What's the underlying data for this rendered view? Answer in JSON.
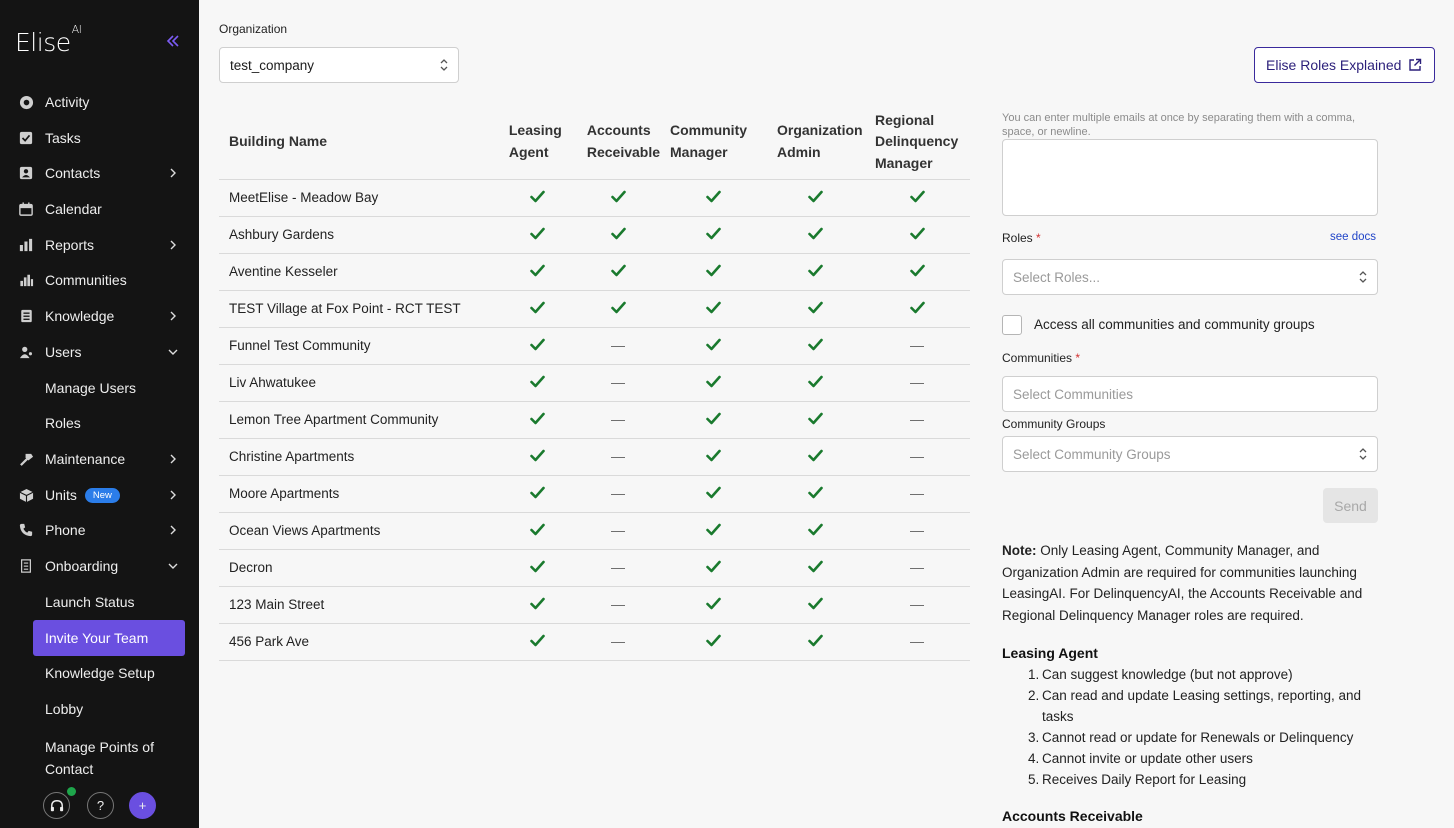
{
  "sidebar": {
    "logo": "Elise",
    "logo_suffix": "AI",
    "nav": [
      {
        "label": "Activity",
        "icon": "activity-icon"
      },
      {
        "label": "Tasks",
        "icon": "tasks-icon"
      },
      {
        "label": "Contacts",
        "icon": "contacts-icon"
      },
      {
        "label": "Calendar",
        "icon": "calendar-icon"
      },
      {
        "label": "Reports",
        "icon": "reports-icon"
      },
      {
        "label": "Communities",
        "icon": "communities-icon"
      },
      {
        "label": "Knowledge",
        "icon": "knowledge-icon"
      },
      {
        "label": "Users",
        "icon": "users-icon"
      },
      {
        "label": "Maintenance",
        "icon": "hammer-icon"
      },
      {
        "label": "Units",
        "icon": "box-icon",
        "badge": "New"
      },
      {
        "label": "Phone",
        "icon": "phone-icon"
      },
      {
        "label": "Onboarding",
        "icon": "building-icon"
      }
    ],
    "users_sub": [
      "Manage Users",
      "Roles"
    ],
    "onboarding_sub": [
      "Launch Status",
      "Invite Your Team",
      "Knowledge Setup",
      "Lobby",
      "Manage Points of",
      "Contact"
    ],
    "footer": {
      "help": "?",
      "add": "+"
    }
  },
  "org": {
    "label": "Organization",
    "value": "test_company"
  },
  "roles_button": "Elise Roles Explained",
  "table": {
    "headers": {
      "building": "Building Name",
      "leasing": [
        "Leasing",
        "Agent"
      ],
      "accounts": [
        "Accounts",
        "Receivable"
      ],
      "community": [
        "Community",
        "Manager"
      ],
      "orgadmin": [
        "Organization",
        "Admin"
      ],
      "regional": [
        "Regional",
        "Delinquency",
        "Manager"
      ]
    },
    "rows": [
      {
        "name": "MeetElise - Meadow Bay",
        "roles": [
          true,
          true,
          true,
          true,
          true
        ]
      },
      {
        "name": "Ashbury Gardens",
        "roles": [
          true,
          true,
          true,
          true,
          true
        ]
      },
      {
        "name": "Aventine Kesseler",
        "roles": [
          true,
          true,
          true,
          true,
          true
        ]
      },
      {
        "name": "TEST Village at Fox Point - RCT TEST",
        "roles": [
          true,
          true,
          true,
          true,
          true
        ]
      },
      {
        "name": "Funnel Test Community",
        "roles": [
          true,
          false,
          true,
          true,
          false
        ]
      },
      {
        "name": "Liv Ahwatukee",
        "roles": [
          true,
          false,
          true,
          true,
          false
        ]
      },
      {
        "name": "Lemon Tree Apartment Community",
        "roles": [
          true,
          false,
          true,
          true,
          false
        ]
      },
      {
        "name": "Christine Apartments",
        "roles": [
          true,
          false,
          true,
          true,
          false
        ]
      },
      {
        "name": "Moore Apartments",
        "roles": [
          true,
          false,
          true,
          true,
          false
        ]
      },
      {
        "name": "Ocean Views Apartments",
        "roles": [
          true,
          false,
          true,
          true,
          false
        ]
      },
      {
        "name": "Decron",
        "roles": [
          true,
          false,
          true,
          true,
          false
        ]
      },
      {
        "name": "123 Main Street",
        "roles": [
          true,
          false,
          true,
          true,
          false
        ]
      },
      {
        "name": "456 Park Ave",
        "roles": [
          true,
          false,
          true,
          true,
          false
        ]
      }
    ]
  },
  "form": {
    "hint": "You can enter multiple emails at once by separating them with a comma, space, or newline.",
    "emails_value": "",
    "roles_label": "Roles",
    "see_docs": "see docs",
    "roles_placeholder": "Select Roles...",
    "access_all_label": "Access all communities and community groups",
    "access_all_checked": false,
    "communities_label": "Communities",
    "communities_placeholder": "Select Communities",
    "groups_label": "Community Groups",
    "groups_placeholder": "Select Community Groups",
    "send": "Send"
  },
  "note": {
    "prefix": "Note:",
    "text": "Only Leasing Agent, Community Manager, and Organization Admin are required for communities launching LeasingAI. For DelinquencyAI, the Accounts Receivable and Regional Delinquency Manager roles are required."
  },
  "role_docs": {
    "leasing_title": "Leasing Agent",
    "leasing_items": [
      "Can suggest knowledge (but not approve)",
      "Can read and update Leasing settings, reporting, and tasks",
      "Cannot read or update for Renewals or Delinquency",
      "Cannot invite or update other users",
      "Receives Daily Report for Leasing"
    ],
    "accounts_title": "Accounts Receivable"
  },
  "colors": {
    "accent": "#6a4fe0",
    "check": "#1a7a2e",
    "sidebar": "#141414"
  }
}
